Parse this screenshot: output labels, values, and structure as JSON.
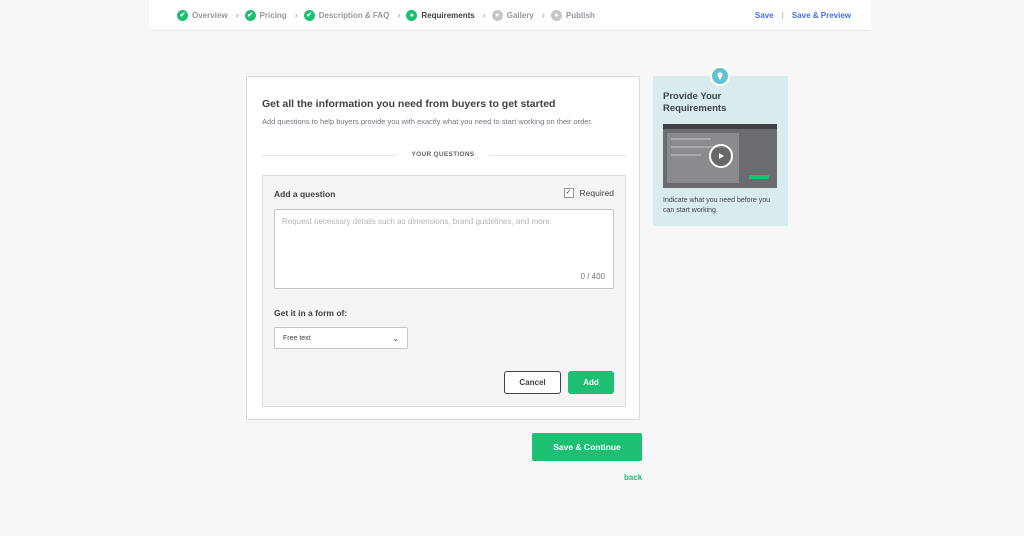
{
  "steps": [
    {
      "label": "Overview",
      "state": "done"
    },
    {
      "label": "Pricing",
      "state": "done"
    },
    {
      "label": "Description & FAQ",
      "state": "done"
    },
    {
      "label": "Requirements",
      "state": "current"
    },
    {
      "label": "Gallery",
      "state": "todo"
    },
    {
      "label": "Publish",
      "state": "todo"
    }
  ],
  "top_actions": {
    "save": "Save",
    "save_preview": "Save & Preview"
  },
  "card": {
    "title": "Get all the information you need from buyers to get started",
    "subtitle": "Add questions to help buyers provide you with exactly what you need to start working on their order.",
    "section_label": "YOUR QUESTIONS"
  },
  "question": {
    "label": "Add a question",
    "required_label": "Required",
    "required_checked": true,
    "placeholder": "Request necessary details such as dimensions, brand guidelines, and more.",
    "value": "",
    "counter": "0 / 400",
    "form_label": "Get it in a form of:",
    "form_value": "Free text",
    "cancel": "Cancel",
    "add": "Add"
  },
  "footer": {
    "save_continue": "Save & Continue",
    "back": "back"
  },
  "help": {
    "title": "Provide Your Requirements",
    "text": "Indicate what you need before you can start working."
  },
  "colors": {
    "accent": "#1dbf73",
    "link": "#446ee7",
    "help_bg": "#d8ecee",
    "bulb": "#5ec2d0"
  }
}
